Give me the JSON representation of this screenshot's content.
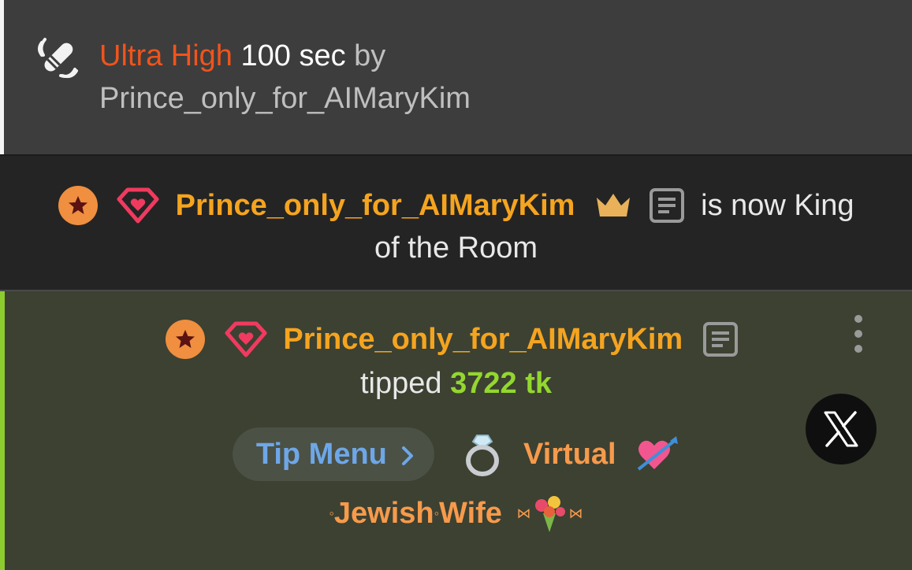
{
  "vibe_event": {
    "icon": "vibrator-icon",
    "level": "Ultra High",
    "duration": "100 sec",
    "by_label": "by",
    "username": "Prince_only_for_AIMaryKim"
  },
  "king_event": {
    "username": "Prince_only_for_AIMaryKim",
    "message_line1": "is now King",
    "message_line2": "of the Room",
    "icons": [
      "star-badge-icon",
      "gem-icon",
      "crown-icon",
      "notes-icon"
    ]
  },
  "tip_event": {
    "username": "Prince_only_for_AIMaryKim",
    "tipped_label": "tipped",
    "amount": "3722 tk",
    "tip_menu_label": "Tip Menu",
    "item_word1": "Virtual",
    "item_line2_prefix": "◦",
    "item_word2": "Jewish",
    "item_separator": "◦",
    "item_word3": "Wife",
    "item_ornament": "⋈",
    "menu_icon": "more-vertical-icon",
    "share_icon": "x-logo-icon"
  },
  "colors": {
    "level": "#f0541c",
    "username": "#f5a41f",
    "amount": "#93d72f",
    "tip_menu": "#6ea7e8",
    "item_text": "#f79a4b",
    "tip_accent_bar": "#8dcc2f"
  }
}
